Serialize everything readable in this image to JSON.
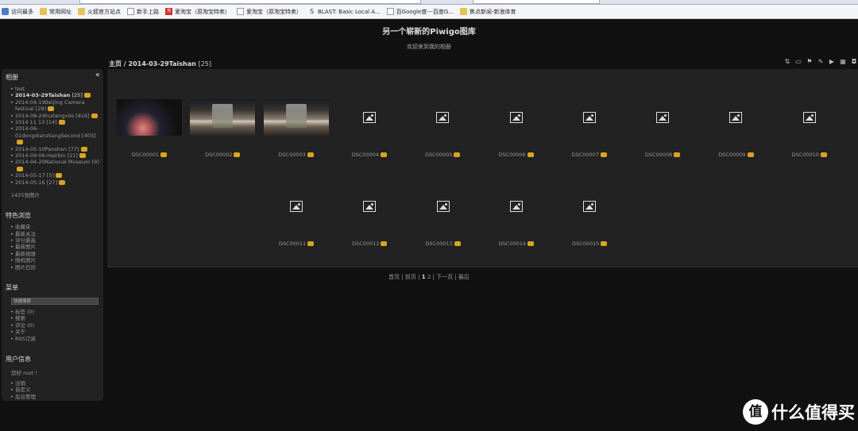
{
  "bookmarks": [
    {
      "label": "访问最多",
      "icon": "star-icon"
    },
    {
      "label": "常用网址",
      "icon": "folder-icon"
    },
    {
      "label": "火狐官方站点",
      "icon": "folder-icon"
    },
    {
      "label": "新手上路",
      "icon": "page-icon"
    },
    {
      "label": "爱淘宝（原淘宝特卖）",
      "icon": "taobao-icon"
    },
    {
      "label": "爱淘宝（原淘宝特卖）",
      "icon": "page-icon"
    },
    {
      "label": "BLAST: Basic Local A...",
      "icon": "blast-icon"
    },
    {
      "label": "百Google度---百度G...",
      "icon": "page-icon"
    },
    {
      "label": "焦点新闻-新浪体育",
      "icon": "news-icon"
    }
  ],
  "site": {
    "title": "另一个崭新的Piwigo图库",
    "subtitle": "欢迎来到我的相册"
  },
  "breadcrumb": {
    "home": "主页",
    "separator": " / ",
    "album": "2014-03-29Taishan",
    "count": "[25]"
  },
  "sidebar": {
    "albums_title": "相册",
    "collapse_glyph": "«",
    "albums": [
      {
        "label": "test",
        "count": "",
        "new": false,
        "current": false
      },
      {
        "label": "2014-03-29Taishan",
        "count": "[25]",
        "new": true,
        "current": true
      },
      {
        "label": "2014-04-19Beijing Camera festival",
        "count": "[28]",
        "new": true,
        "current": false
      },
      {
        "label": "2014-08-24huitengxile",
        "count": "[816]",
        "new": true,
        "current": false
      },
      {
        "label": "2014 11 13",
        "count": "[14]",
        "new": true,
        "current": false
      },
      {
        "label": "2014-06-01dongdianzliangSecond",
        "count": "[403]",
        "new": true,
        "current": false
      },
      {
        "label": "2014-05-10Panshan",
        "count": "[77]",
        "new": true,
        "current": false
      },
      {
        "label": "2014-09-06-Hairbin",
        "count": "[21]",
        "new": true,
        "current": false
      },
      {
        "label": "2014-04-20National Museum",
        "count": "[9]",
        "new": true,
        "current": false
      },
      {
        "label": "2014-05-17",
        "count": "[5]",
        "new": true,
        "current": false
      },
      {
        "label": "2014-05-16",
        "count": "[27]",
        "new": true,
        "current": false
      }
    ],
    "photo_total": "1425张图片",
    "explore_title": "特色浏览",
    "explore": [
      "收藏夹",
      "最新关注",
      "评分最高",
      "最新图片",
      "最新相册",
      "随机图片",
      "图片日历"
    ],
    "menu_title": "菜单",
    "quick_search": "快捷搜索",
    "menu": [
      "标签 (0)",
      "搜索",
      "评论 (0)",
      "关于",
      "RSS订阅"
    ],
    "user_title": "用户信息",
    "hello": "您好 root !",
    "user_links": [
      "注销",
      "自定义",
      "后台管理"
    ]
  },
  "photos": [
    {
      "caption": "DSC00001",
      "kind": "photo1"
    },
    {
      "caption": "DSC00002",
      "kind": "photo2"
    },
    {
      "caption": "DSC00003",
      "kind": "photo3"
    },
    {
      "caption": "DSC00004",
      "kind": "placeholder"
    },
    {
      "caption": "DSC00005",
      "kind": "placeholder"
    },
    {
      "caption": "DSC00006",
      "kind": "placeholder"
    },
    {
      "caption": "DSC00007",
      "kind": "placeholder"
    },
    {
      "caption": "DSC00008",
      "kind": "placeholder"
    },
    {
      "caption": "DSC00009",
      "kind": "placeholder"
    },
    {
      "caption": "DSC00010",
      "kind": "placeholder"
    },
    {
      "caption": "DSC00011",
      "kind": "placeholder"
    },
    {
      "caption": "DSC00012",
      "kind": "placeholder"
    },
    {
      "caption": "DSC00013",
      "kind": "placeholder"
    },
    {
      "caption": "DSC00014",
      "kind": "placeholder"
    },
    {
      "caption": "DSC00015",
      "kind": "placeholder"
    }
  ],
  "pagination": {
    "first": "首页",
    "prev": "前页",
    "pages": [
      "1",
      "2"
    ],
    "current": "1",
    "next": "下一页",
    "last": "最后"
  },
  "watermark": {
    "circle": "值",
    "text": "什么值得买"
  }
}
